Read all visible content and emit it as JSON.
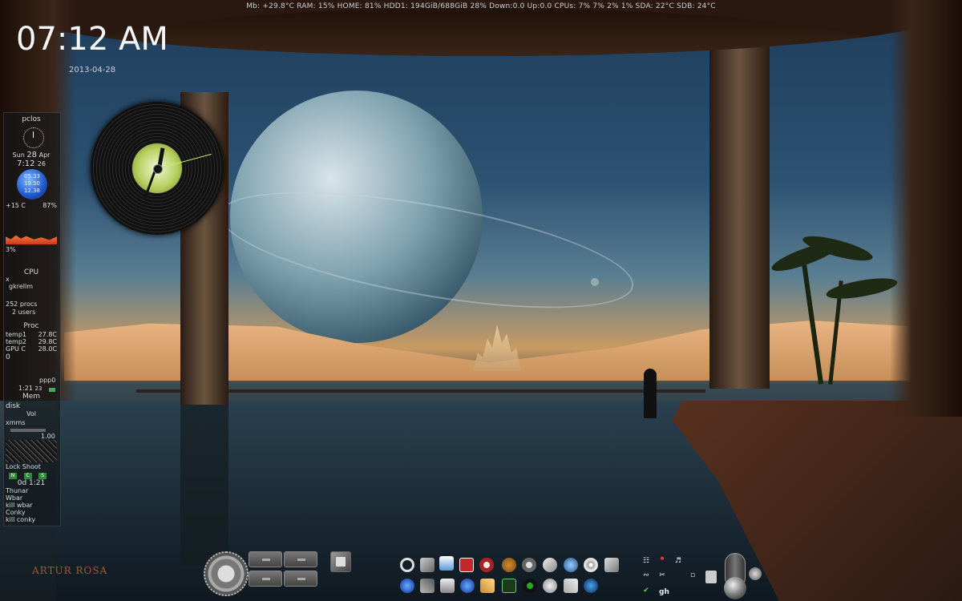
{
  "system_bar": {
    "text": "Mb:  +29.8°C  RAM: 15%  HOME: 81%  HDD1: 194GiB/688GiB 28% Down:0.0  Up:0.0 CPUs: 7% 7% 2% 1% SDA:  22°C SDB:  24°C"
  },
  "clock": {
    "time": "07:12 AM",
    "date": "2013-04-28"
  },
  "gkrellm": {
    "hostname": "pclos",
    "day": "Sun",
    "date_num": "28",
    "month": "Apr",
    "time": "7:12",
    "seconds": "26",
    "globe_times": [
      "05.33",
      "19.50",
      "12.38"
    ],
    "temperature": "+15 C",
    "humidity": "87%",
    "cpu_percent": "3%",
    "cpu_label": "CPU",
    "close_symbol": "x",
    "app_name": "gkrellm",
    "procs": "252 procs",
    "users": "2 users",
    "proc_label": "Proc",
    "sensors": [
      {
        "name": "temp1",
        "value": "27.8C"
      },
      {
        "name": "temp2",
        "value": "29.8C"
      },
      {
        "name": "GPU C",
        "value": "28.0C"
      }
    ],
    "sensor_zero": "0",
    "net_name": "ppp0",
    "net_time": "1:21",
    "net_seconds": "23",
    "mem_label": "Mem",
    "disk_label": "disk",
    "vol_label": "Vol",
    "xmms_label": "xmms",
    "xmms_value": "1.00",
    "lock_label": "Lock",
    "shoot_label": "Shoot",
    "leds": [
      "N",
      "C",
      "S"
    ],
    "uptime": "0d  1:21",
    "launchers": [
      "Thunar",
      "Wbar",
      "kill wbar",
      "Conky",
      "kill conky"
    ]
  },
  "signature": "ARTUR ROSA",
  "tray": {
    "label": "gh"
  },
  "colors": {
    "sky_top": "#1e3c5a",
    "sand": "#e8b482",
    "led_green": "#2e8b3a",
    "vinyl_label": "#b8d060",
    "cpu_graph": "#f07038"
  },
  "icons": {
    "dock_gear": "gear-icon",
    "dock_cube": "cube-icon",
    "tray": [
      "network-icon",
      "thermometer-icon",
      "volume-icon",
      "wireless-icon",
      "scissors-icon",
      "checkmark-icon",
      "mouse-icon",
      "trash-icon"
    ]
  }
}
